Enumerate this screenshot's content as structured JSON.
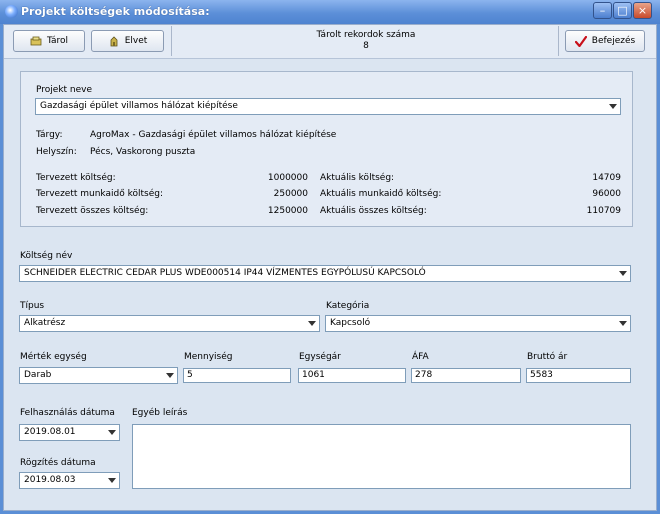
{
  "window": {
    "title": "Projekt költségek módosítása:"
  },
  "toolbar": {
    "save_label": "Tárol",
    "discard_label": "Elvet",
    "records_label": "Tárolt rekordok száma",
    "records_count": "8",
    "finish_label": "Befejezés"
  },
  "project": {
    "label": "Projekt neve",
    "selected": "Gazdasági épület villamos hálózat kiépítése",
    "subject_label": "Tárgy:",
    "subject_value": "AgroMax - Gazdasági épület villamos hálózat kiépítése",
    "location_label": "Helyszín:",
    "location_value": "Pécs, Vaskorong puszta",
    "planned_cost_label": "Tervezett költség:",
    "planned_cost": "1000000",
    "planned_labor_label": "Tervezett munkaidő költség:",
    "planned_labor": "250000",
    "planned_total_label": "Tervezett összes költség:",
    "planned_total": "1250000",
    "actual_cost_label": "Aktuális költség:",
    "actual_cost": "14709",
    "actual_labor_label": "Aktuális munkaidő költség:",
    "actual_labor": "96000",
    "actual_total_label": "Aktuális összes költség:",
    "actual_total": "110709"
  },
  "cost": {
    "name_label": "Költség név",
    "name_value": "SCHNEIDER ELECTRIC CEDAR PLUS WDE000514 IP44 VÍZMENTES EGYPÓLUSÚ KAPCSOLÓ",
    "type_label": "Típus",
    "type_value": "Alkatrész",
    "category_label": "Kategória",
    "category_value": "Kapcsoló",
    "unit_label": "Mérték egység",
    "unit_value": "Darab",
    "qty_label": "Mennyiség",
    "qty_value": "5",
    "unit_price_label": "Egységár",
    "unit_price_value": "1061",
    "vat_label": "ÁFA",
    "vat_value": "278",
    "gross_label": "Bruttó ár",
    "gross_value": "5583",
    "usage_date_label": "Felhasználás dátuma",
    "usage_date_value": "2019.08.01",
    "record_date_label": "Rögzítés dátuma",
    "record_date_value": "2019.08.03",
    "other_desc_label": "Egyéb leírás",
    "other_desc_value": ""
  }
}
